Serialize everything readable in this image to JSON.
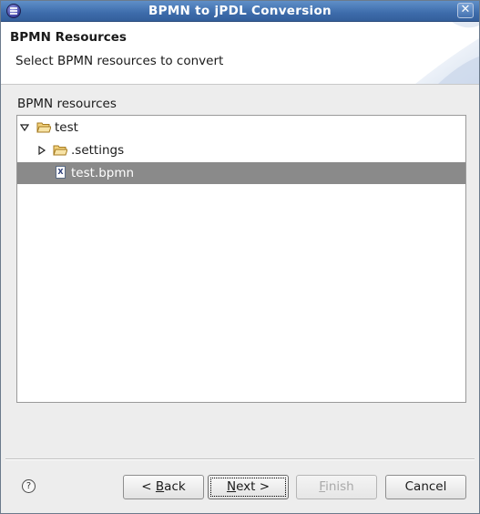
{
  "window": {
    "title": "BPMN to jPDL Conversion",
    "close_glyph": "✕"
  },
  "header": {
    "title": "BPMN Resources",
    "description": "Select BPMN resources to convert"
  },
  "tree_section": {
    "label": "BPMN resources",
    "items": [
      {
        "label": "test",
        "type": "folder",
        "expanded": true,
        "selected": false
      },
      {
        "label": ".settings",
        "type": "folder",
        "expanded": false,
        "selected": false
      },
      {
        "label": "test.bpmn",
        "type": "file",
        "selected": true,
        "icon_glyph": "X"
      }
    ]
  },
  "buttons": {
    "help_glyph": "?",
    "back": {
      "prefix": "< ",
      "mnemonic": "B",
      "rest": "ack"
    },
    "next": {
      "mnemonic": "N",
      "rest": "ext >"
    },
    "finish": {
      "mnemonic": "F",
      "rest": "inish",
      "enabled": false
    },
    "cancel": "Cancel"
  },
  "colors": {
    "titlebar": "#3d6cab",
    "selection": "#8a8a8a",
    "folder": "#e8b44a"
  }
}
